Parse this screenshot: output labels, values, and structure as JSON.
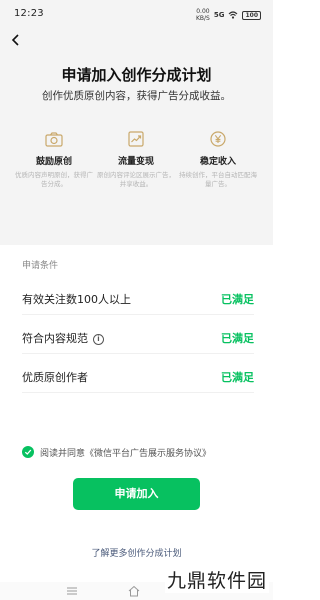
{
  "status_bar": {
    "time": "12:23",
    "speed_value": "0.00",
    "speed_unit": "KB/S",
    "network": "5G",
    "battery": "100"
  },
  "header": {
    "title": "申请加入创作分成计划",
    "subtitle": "创作优质原创内容，获得广告分成收益。"
  },
  "features": [
    {
      "icon": "camera-icon",
      "label": "鼓励原创",
      "desc": "优质内容声明原创，获得广告分成。"
    },
    {
      "icon": "trend-chart-icon",
      "label": "流量变现",
      "desc": "原创内容评论区展示广告，并享收益。"
    },
    {
      "icon": "yen-coin-icon",
      "label": "稳定收入",
      "desc": "持续创作，平台自动匹配海量广告。"
    }
  ],
  "conditions": {
    "section_label": "申请条件",
    "rows": [
      {
        "label": "有效关注数100人以上",
        "status": "已满足"
      },
      {
        "label": "符合内容规范",
        "status": "已满足"
      },
      {
        "label": "优质原创作者",
        "status": "已满足"
      }
    ]
  },
  "agreement": {
    "text": "阅读并同意《微信平台广告展示服务协议》",
    "checked": true
  },
  "apply_button": "申请加入",
  "learn_more": "了解更多创作分成计划",
  "watermark": "九鼎软件园",
  "colors": {
    "accent": "#07c160",
    "link": "#4a5a7a",
    "icon_gold": "#c9a86a"
  }
}
